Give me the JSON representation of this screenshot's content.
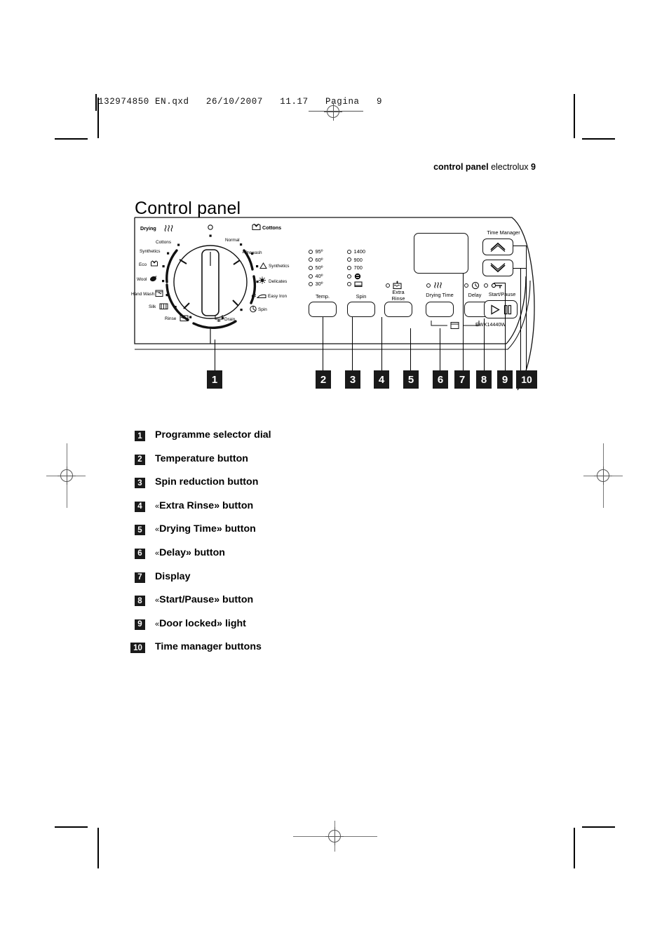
{
  "print_marks": {
    "file_header": "132974850 EN.qxd   26/10/2007   11.17   Pagina   9"
  },
  "running_head": {
    "section": "control panel",
    "brand": "electrolux",
    "page_number": "9"
  },
  "page_title": "Control panel",
  "figure": {
    "dial": {
      "group_left_title": "Drying",
      "group_right_title": "Cottons",
      "left_programmes": [
        "Cottons",
        "Synthetics",
        "Eco",
        "Wool",
        "Hand Wash",
        "Silk",
        "Rinse"
      ],
      "right_programmes": [
        "Normal",
        "+Prewash",
        "Synthetics",
        "Delicates",
        "Easy Iron",
        "Spin",
        "Drain"
      ],
      "off_position": "O"
    },
    "temperature": {
      "label": "Temp.",
      "options": [
        "95º",
        "60º",
        "50º",
        "40º",
        "30º"
      ]
    },
    "spin": {
      "label": "Spin",
      "options": [
        "1400",
        "900",
        "700",
        "no-spin-icon",
        "rinse-hold-icon"
      ]
    },
    "extra_rinse": {
      "label_line1": "Extra",
      "label_line2": "Rinse",
      "icon": "extra-rinse-icon"
    },
    "drying_time": {
      "label": "Drying Time",
      "icon": "drying-icon"
    },
    "delay": {
      "label": "Delay",
      "icon": "clock-icon"
    },
    "display": {
      "label": ""
    },
    "time_manager": {
      "label": "Time Manager",
      "up_icon": "chevron-up-icon",
      "down_icon": "chevron-down-icon"
    },
    "start_pause": {
      "label": "Start/Pause",
      "door_lock_icon": "door-locked-icon",
      "play_icon": "play-icon",
      "pause_icon": "pause-icon"
    },
    "model_number": "EWX14440W",
    "callout_numbers": [
      "1",
      "2",
      "3",
      "4",
      "5",
      "6",
      "7",
      "8",
      "9",
      "10"
    ]
  },
  "legend": [
    {
      "num": "1",
      "text": "Programme selector dial",
      "pre": "",
      "post": ""
    },
    {
      "num": "2",
      "text": "Temperature button",
      "pre": "",
      "post": ""
    },
    {
      "num": "3",
      "text": "Spin reduction button",
      "pre": "",
      "post": ""
    },
    {
      "num": "4",
      "text": "Extra Rinse",
      "pre": "«",
      "post": "» button"
    },
    {
      "num": "5",
      "text": "Drying Time",
      "pre": "«",
      "post": "» button"
    },
    {
      "num": "6",
      "text": "Delay",
      "pre": "«",
      "post": "» button"
    },
    {
      "num": "7",
      "text": "Display",
      "pre": "",
      "post": ""
    },
    {
      "num": "8",
      "text": "Start/Pause",
      "pre": "«",
      "post": "» button"
    },
    {
      "num": "9",
      "text": "Door locked",
      "pre": "«",
      "post": "» light"
    },
    {
      "num": "10",
      "text": "Time manager buttons",
      "pre": "",
      "post": ""
    }
  ]
}
